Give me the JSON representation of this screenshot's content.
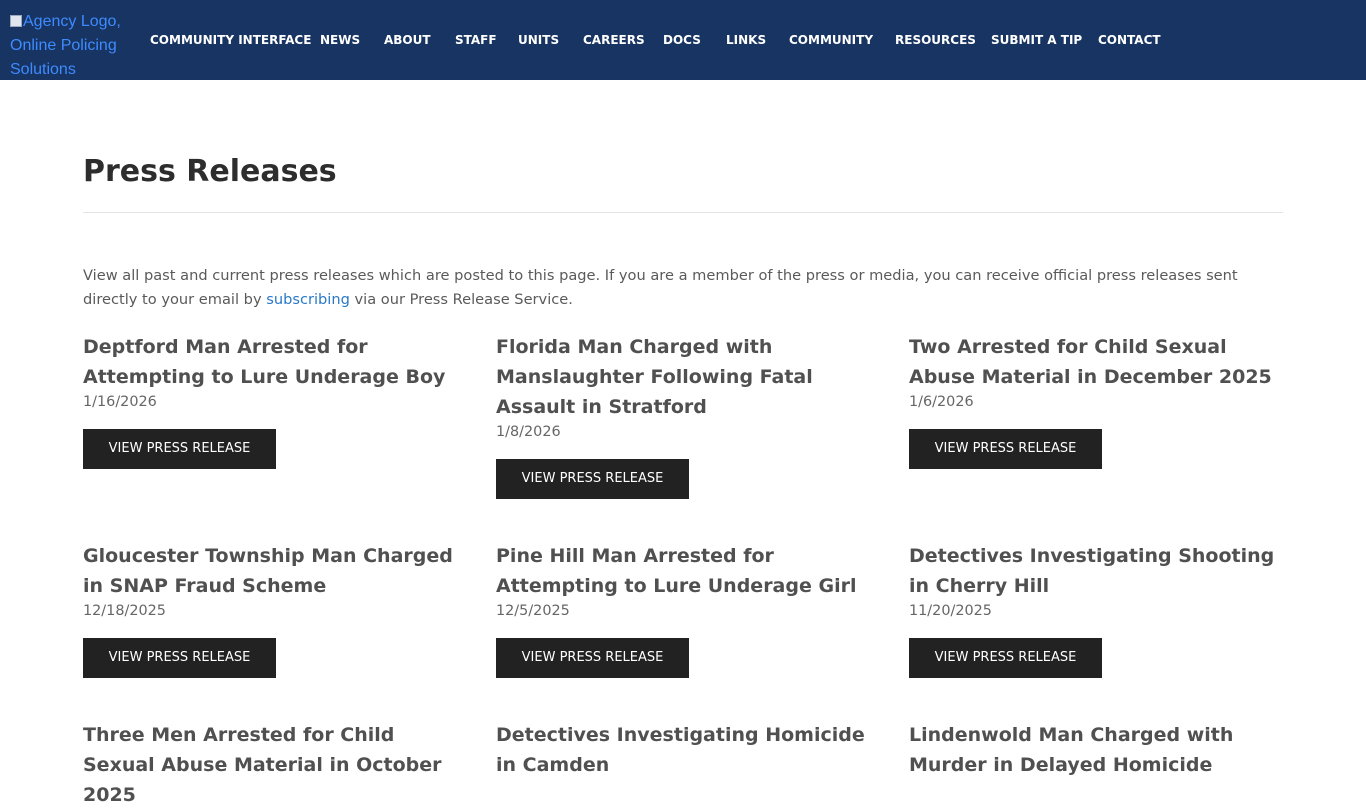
{
  "header": {
    "logo_alt": "Agency Logo, Online Policing Solutions",
    "nav": [
      "COMMUNITY INTERFACE",
      "NEWS",
      "ABOUT",
      "STAFF",
      "UNITS",
      "CAREERS",
      "DOCS",
      "LINKS",
      "COMMUNITY",
      "RESOURCES",
      "SUBMIT A TIP",
      "CONTACT"
    ]
  },
  "page": {
    "title": "Press Releases",
    "intro_before": "View all past and current press releases which are posted to this page. If you are a member of the press or media, you can receive official press releases sent directly to your email by ",
    "intro_link": "subscribing",
    "intro_after": " via our Press Release Service."
  },
  "releases": [
    {
      "title": "Deptford Man Arrested for Attempting to Lure Underage Boy",
      "date": "1/16/2026",
      "button": "VIEW PRESS RELEASE"
    },
    {
      "title": "Florida Man Charged with Manslaughter Following Fatal Assault in Stratford",
      "date": "1/8/2026",
      "button": "VIEW PRESS RELEASE"
    },
    {
      "title": "Two Arrested for Child Sexual Abuse Material in December 2025",
      "date": "1/6/2026",
      "button": "VIEW PRESS RELEASE"
    },
    {
      "title": "Gloucester Township Man Charged in SNAP Fraud Scheme",
      "date": "12/18/2025",
      "button": "VIEW PRESS RELEASE"
    },
    {
      "title": "Pine Hill Man Arrested for Attempting to Lure Underage Girl",
      "date": "12/5/2025",
      "button": "VIEW PRESS RELEASE"
    },
    {
      "title": "Detectives Investigating Shooting in Cherry Hill",
      "date": "11/20/2025",
      "button": "VIEW PRESS RELEASE"
    },
    {
      "title": "Three Men Arrested for Child Sexual Abuse Material in October 2025",
      "date": "",
      "button": ""
    },
    {
      "title": "Detectives Investigating Homicide in Camden",
      "date": "",
      "button": ""
    },
    {
      "title": "Lindenwold Man Charged with Murder in Delayed Homicide",
      "date": "",
      "button": ""
    }
  ],
  "colors": {
    "nav_bg": "#183462",
    "button_bg": "#222222",
    "link": "#2a78c8"
  }
}
